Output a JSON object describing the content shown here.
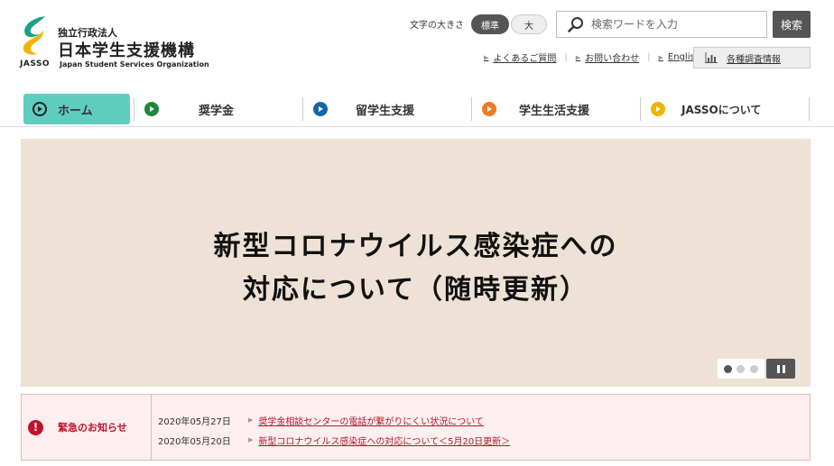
{
  "header": {
    "org_type": "独立行政法人",
    "org_name": "日本学生支援機構",
    "abbr": "JASSO",
    "org_name_en": "Japan Student Services Organization",
    "font_size_label": "文字の大きさ",
    "font_size_standard": "標準",
    "font_size_large": "大",
    "search_placeholder": "検索ワードを入力",
    "search_button": "検索",
    "util_links": [
      "よくあるご質問",
      "お問い合わせ",
      "English"
    ],
    "survey_button": "各種調査情報"
  },
  "nav": {
    "items": [
      {
        "label": "ホーム",
        "color": "#222222"
      },
      {
        "label": "奨学金",
        "color": "#1a8a3a"
      },
      {
        "label": "留学生支援",
        "color": "#1266a8"
      },
      {
        "label": "学生生活支援",
        "color": "#ee7a22"
      },
      {
        "label": "JASSOについて",
        "color": "#f0b400"
      }
    ],
    "active_color": "#5ecdc0"
  },
  "hero": {
    "title_line1": "新型コロナウイルス感染症への",
    "title_line2": "対応について（随時更新）",
    "slide_count": 3,
    "active_slide": 1
  },
  "notice": {
    "title": "緊急のお知らせ",
    "items": [
      {
        "date": "2020年05月27日",
        "text": "奨学金相談センターの電話が繋がりにくい状況について"
      },
      {
        "date": "2020年05月20日",
        "text": "新型コロナウイルス感染症への対応について＜5月20日更新＞"
      }
    ]
  }
}
